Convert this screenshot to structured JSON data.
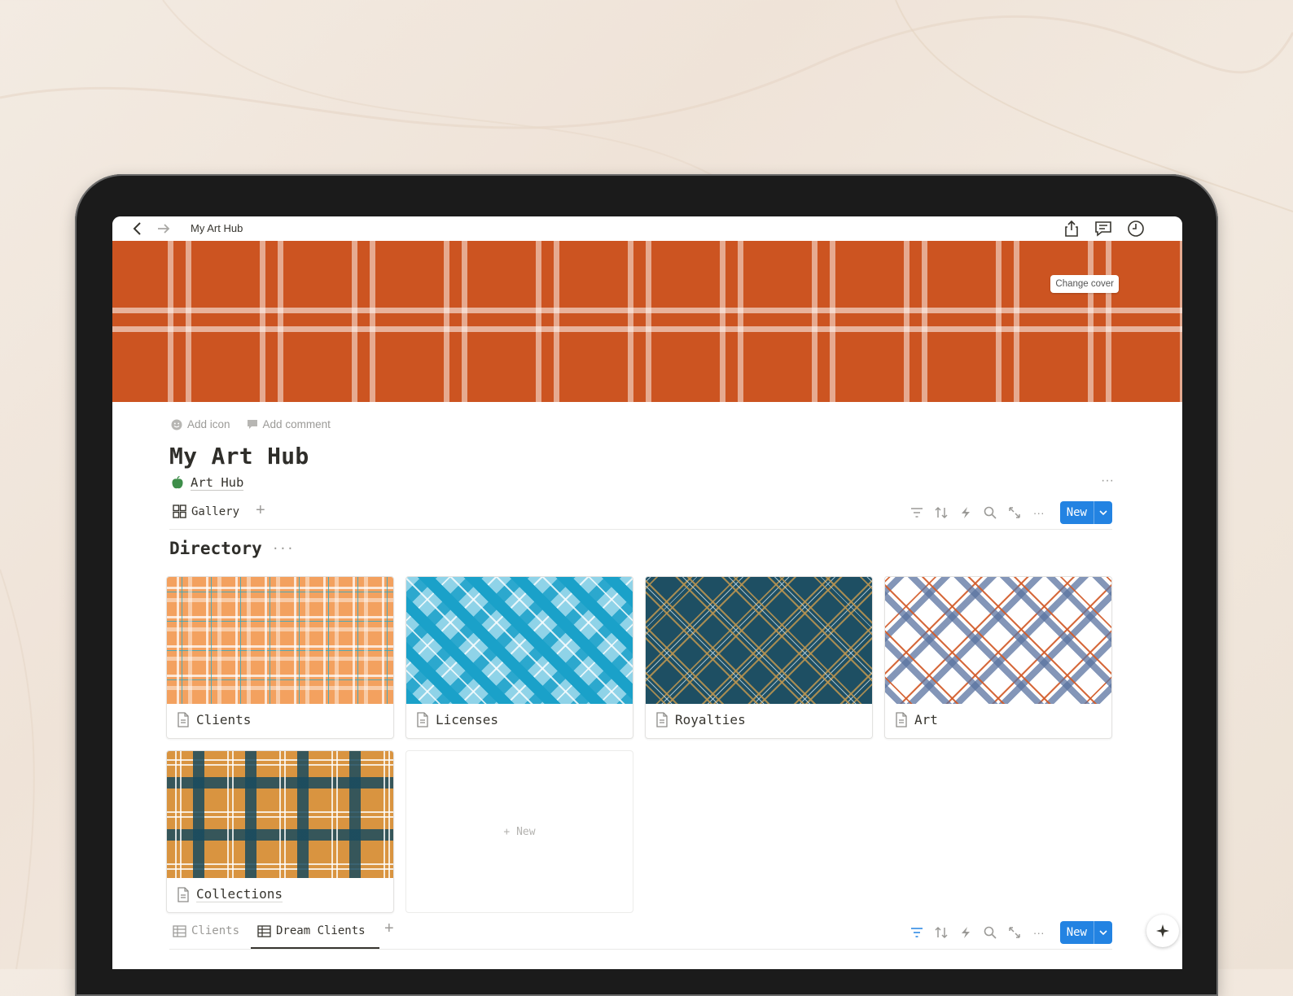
{
  "breadcrumb": "My Art Hub",
  "cover": {
    "change_label": "Change cover",
    "color": "#cc5421"
  },
  "meta": {
    "add_icon": "Add icon",
    "add_comment": "Add comment"
  },
  "page": {
    "title": "My Art Hub",
    "subtitle": "Art Hub",
    "subtitle_icon": "apple-icon"
  },
  "view": {
    "tab_label": "Gallery",
    "new_label": "New"
  },
  "section": {
    "title": "Directory"
  },
  "cards": [
    {
      "label": "Clients"
    },
    {
      "label": "Licenses"
    },
    {
      "label": "Royalties"
    },
    {
      "label": "Art"
    },
    {
      "label": "Collections"
    }
  ],
  "new_card_label": "+ New",
  "bottom_tabs": [
    {
      "label": "Clients",
      "active": false
    },
    {
      "label": "Dream Clients",
      "active": true
    }
  ],
  "bottom_new_label": "New",
  "accent_color": "#2383e2"
}
